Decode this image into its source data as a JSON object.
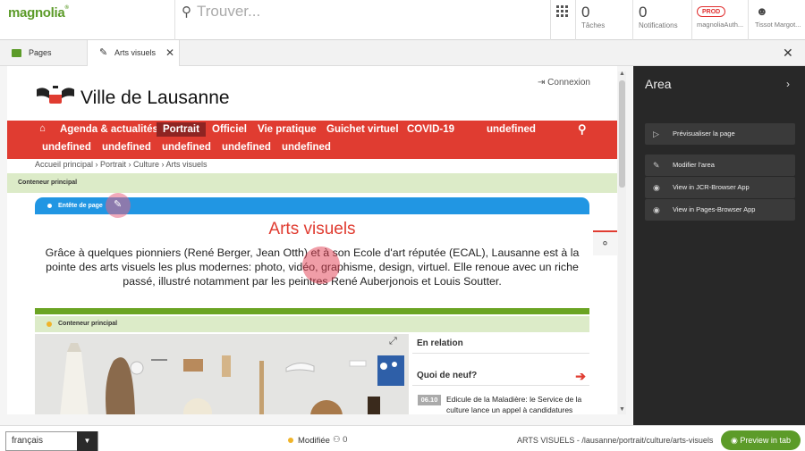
{
  "topbar": {
    "logo": "magnolia",
    "logo_mark": "®",
    "search_placeholder": "Trouver...",
    "tasks": {
      "count": "0",
      "label": "Tâches"
    },
    "notifications": {
      "count": "0",
      "label": "Notifications"
    },
    "env_badge": "PROD",
    "env_user": "magnoliaAuth...",
    "user_name": "Tissot Margot..."
  },
  "tabs": {
    "pages_label": "Pages",
    "active_label": "Arts visuels"
  },
  "site": {
    "title": "Ville de Lausanne",
    "connexion": "Connexion",
    "nav_row1": [
      "Agenda & actualités",
      "Portrait",
      "Officiel",
      "Vie pratique",
      "Guichet virtuel",
      "COVID-19",
      "undefined"
    ],
    "nav_row2": [
      "undefined",
      "undefined",
      "undefined",
      "undefined",
      "undefined"
    ],
    "breadcrumb": "Accueil principal › Portrait › Culture › Arts visuels",
    "outer_area": "Conteneur principal",
    "header_area": "Entête de page",
    "heading": "Arts visuels",
    "intro": "Grâce à quelques pionniers (René Berger, Jean Otth) et à son Ecole d'art réputée (ECAL), Lausanne est à la pointe des arts visuels les plus modernes: photo, vidéo, graphisme, design, virtuel. Elle renoue avec un riche passé, illustré notamment par les peintres René Auberjonois et Louis Soutter.",
    "inner_area": "Conteneur principal",
    "related": "En relation",
    "news_title": "Quoi de neuf?",
    "news_date": "06.10",
    "news_text": "Edicule de la Maladière: le Service de la culture lance un appel à candidatures"
  },
  "panel": {
    "title": "Area",
    "actions": [
      "Prévisualiser la page",
      "Modifier l'area",
      "View in JCR-Browser App",
      "View in Pages-Browser App"
    ]
  },
  "footer": {
    "language": "français",
    "status": "Modifiée",
    "users": "0",
    "path": "ARTS VISUELS - /lausanne/portrait/culture/arts-visuels",
    "preview_button": "Preview in tab"
  },
  "colors": {
    "brand_green": "#5c9b29",
    "lausanne_red": "#e03c31",
    "panel_dark": "#282828",
    "area_blue": "#2196e3"
  }
}
